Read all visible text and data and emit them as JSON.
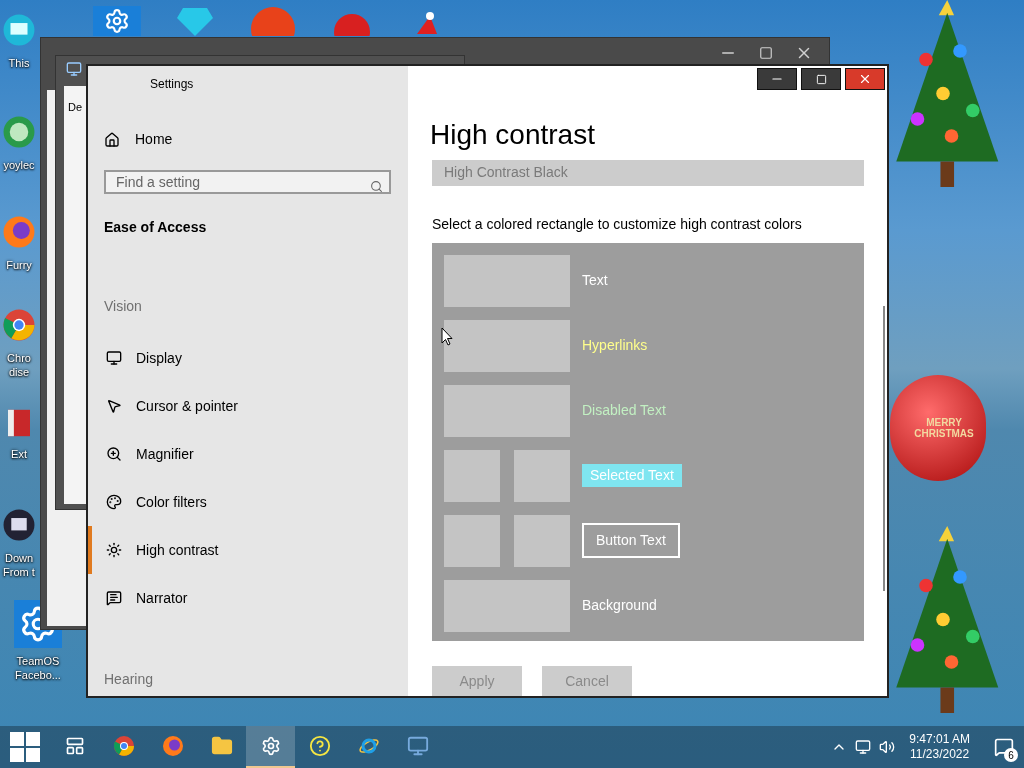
{
  "desktop": {
    "icons": [
      {
        "kind": "monitor",
        "lines": [
          "This"
        ]
      },
      {
        "kind": "globe",
        "lines": [
          "yoylec"
        ]
      },
      {
        "kind": "firefox",
        "lines": [
          "Furry"
        ]
      },
      {
        "kind": "chrome",
        "lines": [
          "Chro",
          "dise"
        ]
      },
      {
        "kind": "box",
        "lines": [
          "Ext"
        ]
      },
      {
        "kind": "download",
        "lines": [
          "Down",
          "From t"
        ]
      },
      {
        "kind": "gear",
        "lines": [
          "TeamOS",
          "Facebo..."
        ]
      }
    ],
    "greeting": "MERRY CHRISTMAS"
  },
  "back_window": {
    "label": "De"
  },
  "settings": {
    "title": "Settings",
    "home": "Home",
    "search": {
      "placeholder": "Find a setting"
    },
    "category": "Ease of Access",
    "sections": [
      {
        "header": "Vision",
        "items": [
          {
            "label": "Display",
            "selected": false
          },
          {
            "label": "Cursor & pointer",
            "selected": false
          },
          {
            "label": "Magnifier",
            "selected": false
          },
          {
            "label": "Color filters",
            "selected": false
          },
          {
            "label": "High contrast",
            "selected": true
          },
          {
            "label": "Narrator",
            "selected": false
          }
        ]
      },
      {
        "header": "Hearing"
      }
    ],
    "page": {
      "title": "High contrast",
      "theme": "High Contrast Black",
      "instruction": "Select a colored rectangle to customize high contrast colors",
      "colors": [
        {
          "kind": "text",
          "label": "Text",
          "color": "#ffffff"
        },
        {
          "kind": "text",
          "label": "Hyperlinks",
          "color": "#ffff8c"
        },
        {
          "kind": "text",
          "label": "Disabled Text",
          "color": "#c2f0c2"
        },
        {
          "kind": "selected",
          "label": "Selected Text",
          "color": "#7fe5f0"
        },
        {
          "kind": "button",
          "label": "Button Text",
          "color": "#ffffff"
        },
        {
          "kind": "text",
          "label": "Background",
          "color": "#ffffff"
        }
      ],
      "buttons": [
        {
          "label": "Apply",
          "disabled": true
        },
        {
          "label": "Cancel",
          "disabled": true
        }
      ]
    }
  },
  "taskbar": {
    "apps": [
      {
        "kind": "taskview",
        "active": false
      },
      {
        "kind": "chrome",
        "active": false
      },
      {
        "kind": "firefox",
        "active": false
      },
      {
        "kind": "folder",
        "active": false
      },
      {
        "kind": "settings",
        "active": true
      },
      {
        "kind": "help",
        "active": false
      },
      {
        "kind": "ie",
        "active": false
      },
      {
        "kind": "monitor",
        "active": false
      }
    ],
    "time": "9:47:01 AM",
    "date": "11/23/2022",
    "notifications": "6"
  }
}
